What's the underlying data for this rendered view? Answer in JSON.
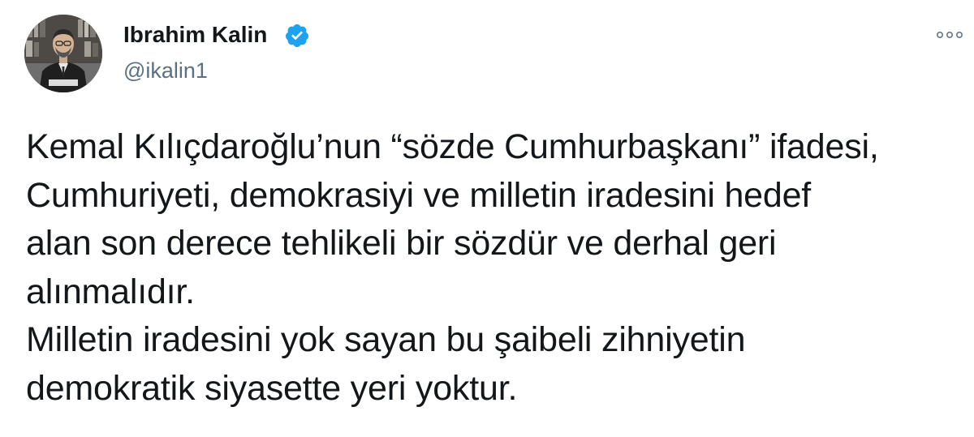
{
  "author": {
    "display_name": "Ibrahim Kalin",
    "handle": "@ikalin1",
    "verified": true,
    "avatar_icon": "profile-photo"
  },
  "menu": {
    "more_icon": "more-dots-icon"
  },
  "colors": {
    "verified_badge": "#1da1f2",
    "text_primary": "#14171a",
    "text_secondary": "#5b7083"
  },
  "tweet": {
    "lines": [
      "Kemal Kılıçdaroğlu’nun “sözde Cumhurbaşkanı” ifadesi,",
      "Cumhuriyeti, demokrasiyi ve milletin iradesini hedef",
      "alan son derece tehlikeli bir sözdür ve derhal geri",
      "alınmalıdır.",
      "Milletin iradesini yok sayan bu şaibeli zihniyetin",
      "demokratik siyasette yeri yoktur."
    ]
  }
}
